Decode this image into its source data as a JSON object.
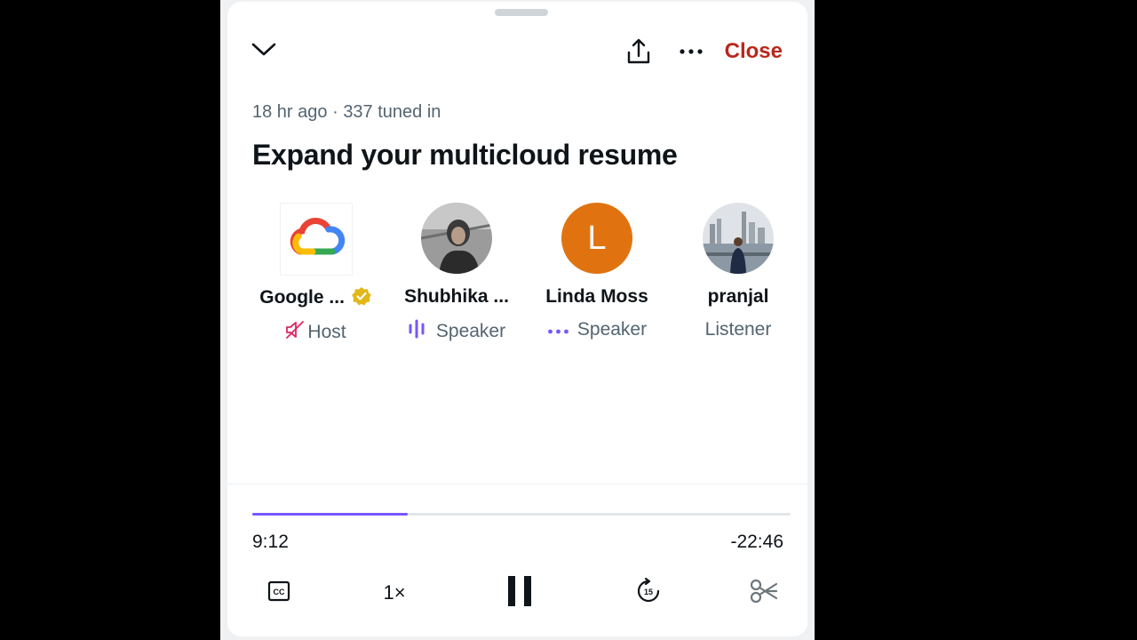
{
  "header": {
    "close_label": "Close"
  },
  "space": {
    "ago": "18 hr ago",
    "separator": "·",
    "tuned_in": "337 tuned in",
    "title": "Expand your multicloud resume"
  },
  "participants": [
    {
      "name": "Google ...",
      "role": "Host",
      "avatar": "google-cloud-logo",
      "verified": true,
      "status_icon": "mic-muted-icon",
      "status_color": "#e0245e"
    },
    {
      "name": "Shubhika ...",
      "role": "Speaker",
      "avatar": "photo",
      "status_icon": "speaking-waveform-icon",
      "status_color": "#7856ff"
    },
    {
      "name": "Linda Moss",
      "role": "Speaker",
      "avatar_letter": "L",
      "avatar_color": "#e0730f",
      "status_icon": "dots-icon",
      "status_color": "#7856ff"
    },
    {
      "name": "pranjal",
      "role": "Listener",
      "avatar": "photo"
    }
  ],
  "player": {
    "elapsed": "9:12",
    "remaining": "-22:46",
    "progress_fraction": 0.288,
    "speed_label": "1×",
    "accent_color": "#7856ff"
  },
  "colors": {
    "close": "#b8271b",
    "verified": "#e2b719"
  }
}
